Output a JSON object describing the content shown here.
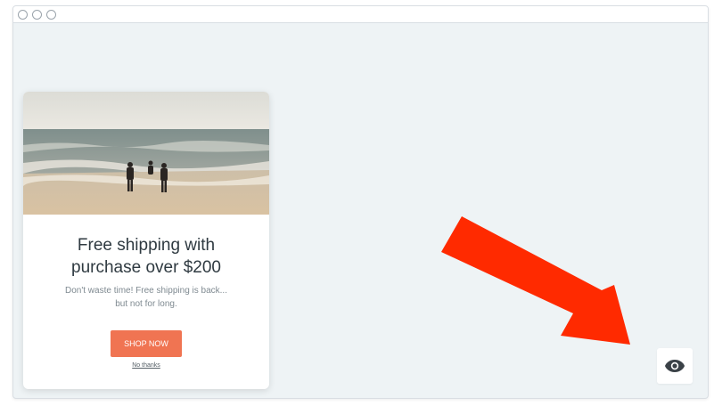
{
  "popup": {
    "headline_line1": "Free shipping with",
    "headline_line2": "purchase over $200",
    "subtext_line1": "Don't waste time! Free shipping is back...",
    "subtext_line2": "but not for long.",
    "cta_label": "SHOP NOW",
    "dismiss_label": "No thanks"
  },
  "icons": {
    "preview": "eye-icon",
    "annotation": "red-arrow"
  },
  "colors": {
    "cta": "#f07452",
    "arrow": "#ff2a00",
    "canvas": "#eef3f5"
  }
}
